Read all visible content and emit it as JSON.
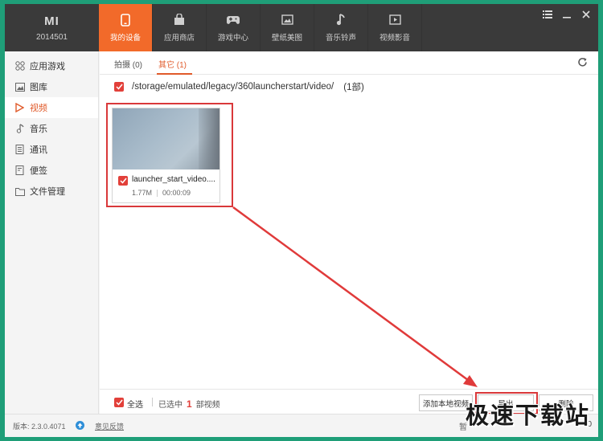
{
  "device": {
    "logo": "MI",
    "id": "2014501"
  },
  "nav": [
    {
      "label": "我的设备",
      "icon": "phone-icon",
      "active": true
    },
    {
      "label": "应用商店",
      "icon": "shopping-bag-icon"
    },
    {
      "label": "游戏中心",
      "icon": "gamepad-icon"
    },
    {
      "label": "壁纸美图",
      "icon": "picture-icon"
    },
    {
      "label": "音乐铃声",
      "icon": "music-note-icon"
    },
    {
      "label": "视频影音",
      "icon": "video-play-icon"
    }
  ],
  "sidebar": {
    "items": [
      {
        "label": "应用游戏",
        "icon": "apps-icon"
      },
      {
        "label": "图库",
        "icon": "image-icon"
      },
      {
        "label": "视频",
        "icon": "play-icon",
        "active": true
      },
      {
        "label": "音乐",
        "icon": "music-icon"
      },
      {
        "label": "通讯",
        "icon": "contacts-icon"
      },
      {
        "label": "便签",
        "icon": "note-icon"
      },
      {
        "label": "文件管理",
        "icon": "folder-icon"
      }
    ]
  },
  "tabs": [
    {
      "label": "拍摄 (0)"
    },
    {
      "label": "其它 (1)",
      "active": true
    }
  ],
  "path": {
    "text": "/storage/emulated/legacy/360launcherstart/video/",
    "count": "(1部)"
  },
  "video": {
    "name": "launcher_start_video....",
    "size": "1.77M",
    "duration": "00:00:09"
  },
  "footer": {
    "select_all": "全选",
    "selected_prefix": "已选中",
    "selected_count": "1",
    "selected_suffix": "部视频",
    "add_local": "添加本地视频",
    "export": "导出",
    "delete": "删除"
  },
  "status": {
    "version": "版本: 2.3.0.4071",
    "feedback": "意见反馈",
    "storage_fragment": "暂",
    "count_fragment": "0"
  },
  "watermark": "极速下载站",
  "colors": {
    "accent": "#f26a2a",
    "highlight": "#d9383a",
    "header": "#3a3a3a",
    "frame": "#1f9e78"
  }
}
